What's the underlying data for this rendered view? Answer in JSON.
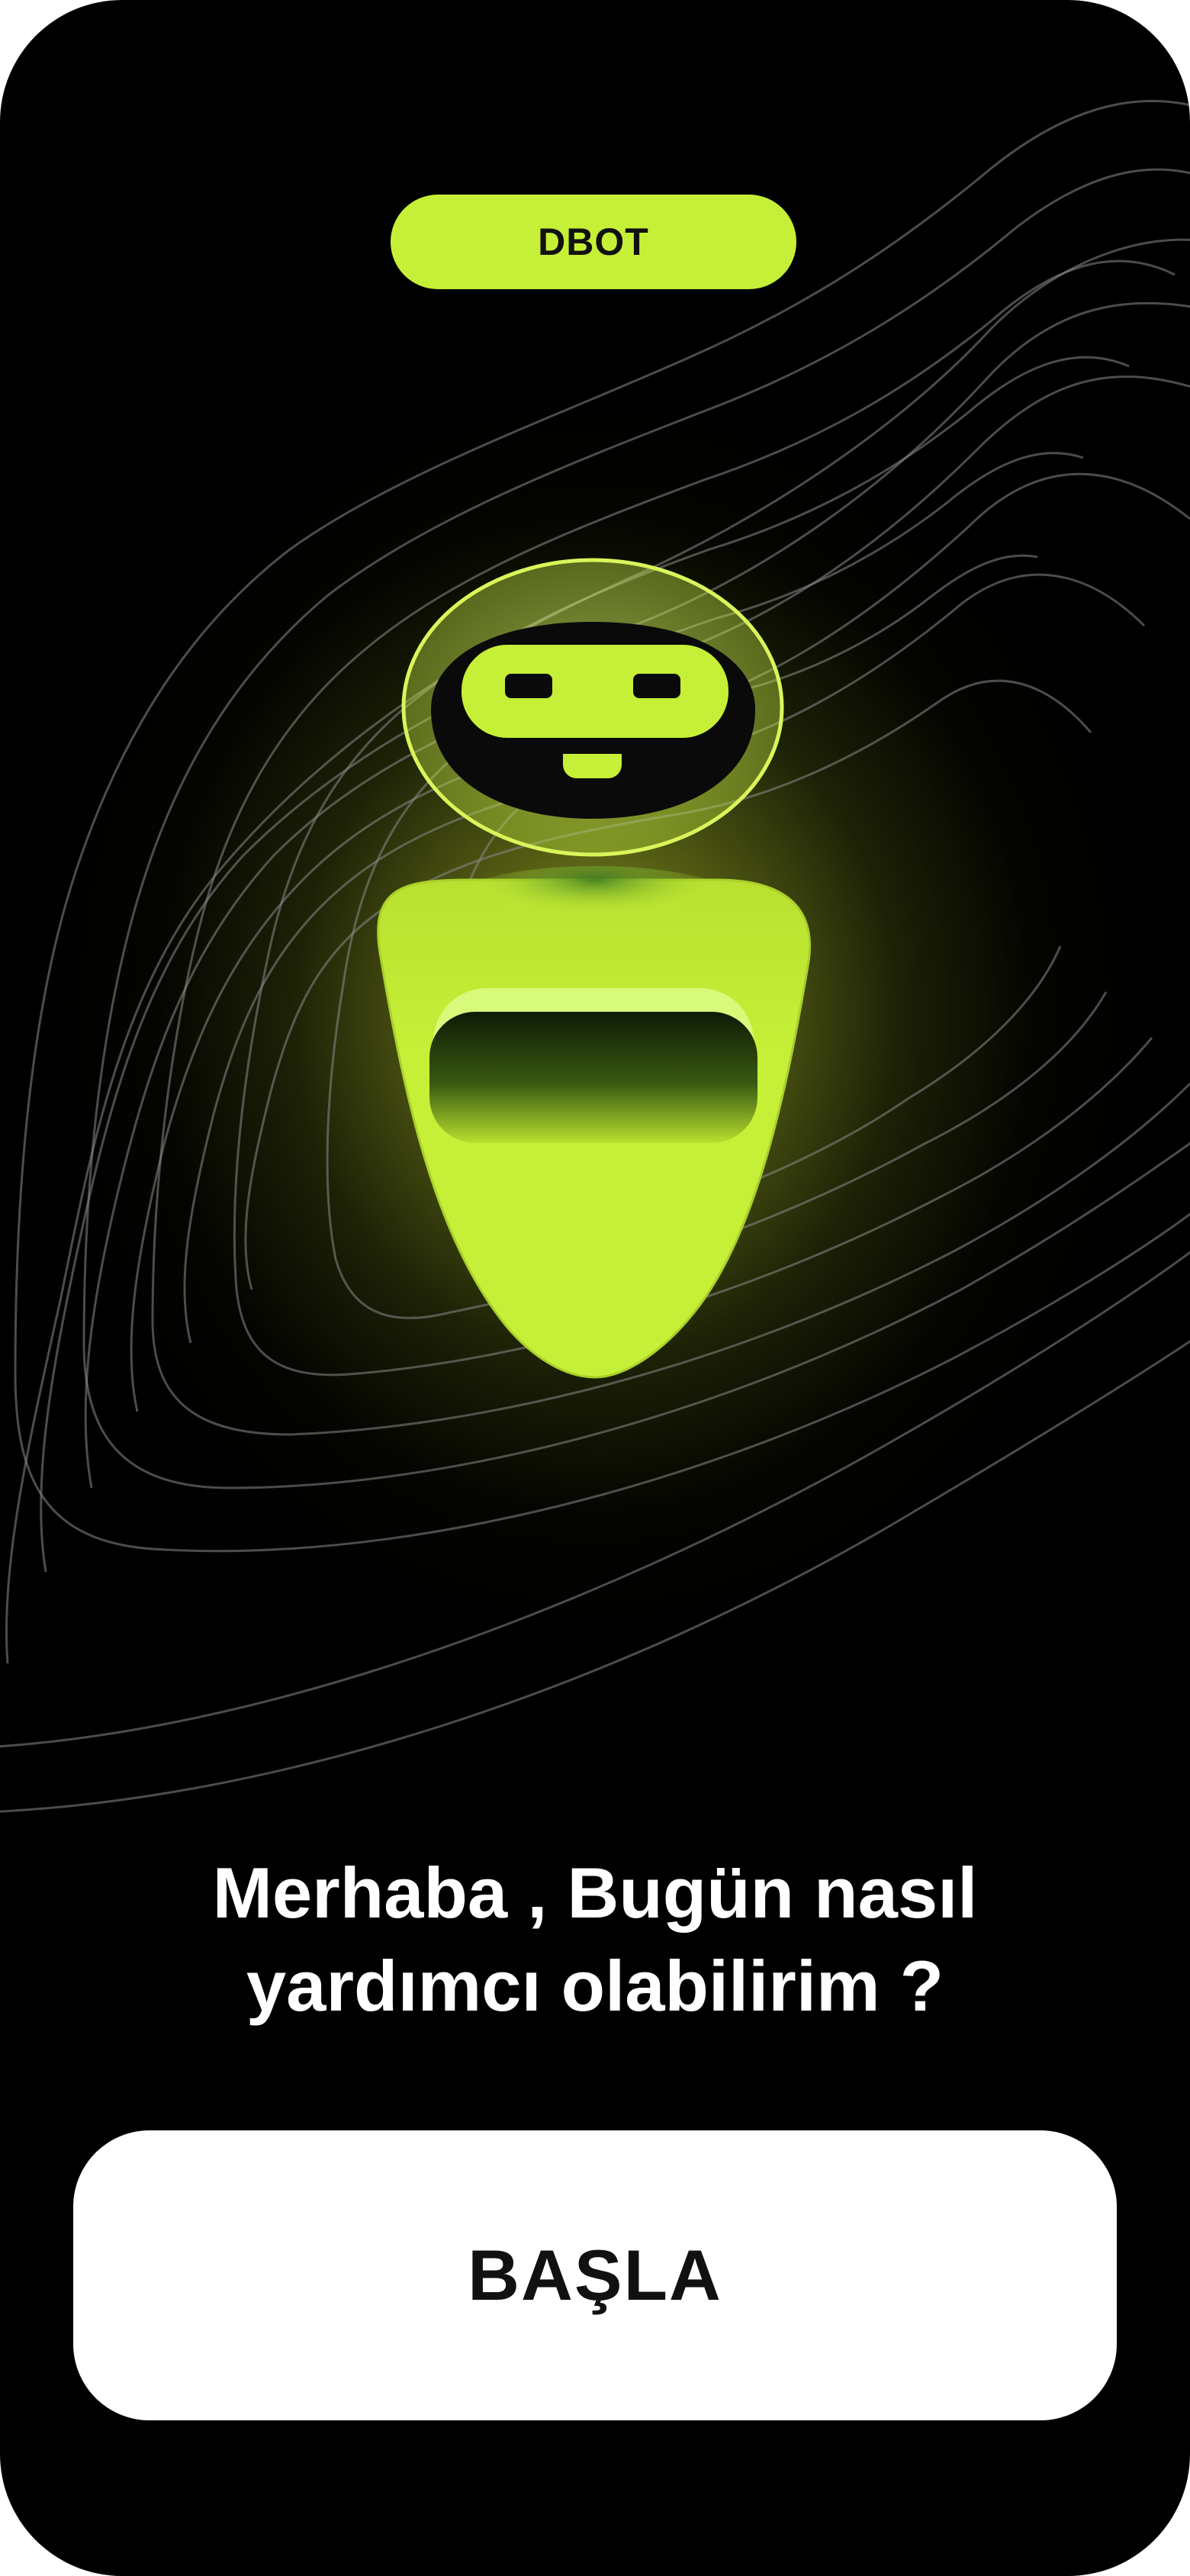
{
  "header": {
    "badge_label": "DBOT"
  },
  "hero": {
    "illustration": "robot-mascot",
    "accent_color": "#c5f037",
    "background_color": "#000000"
  },
  "greeting": {
    "line1": "Merhaba , Bugün nasıl",
    "line2": "yardımcı olabilirim ?"
  },
  "actions": {
    "start_label": "BAŞLA"
  }
}
